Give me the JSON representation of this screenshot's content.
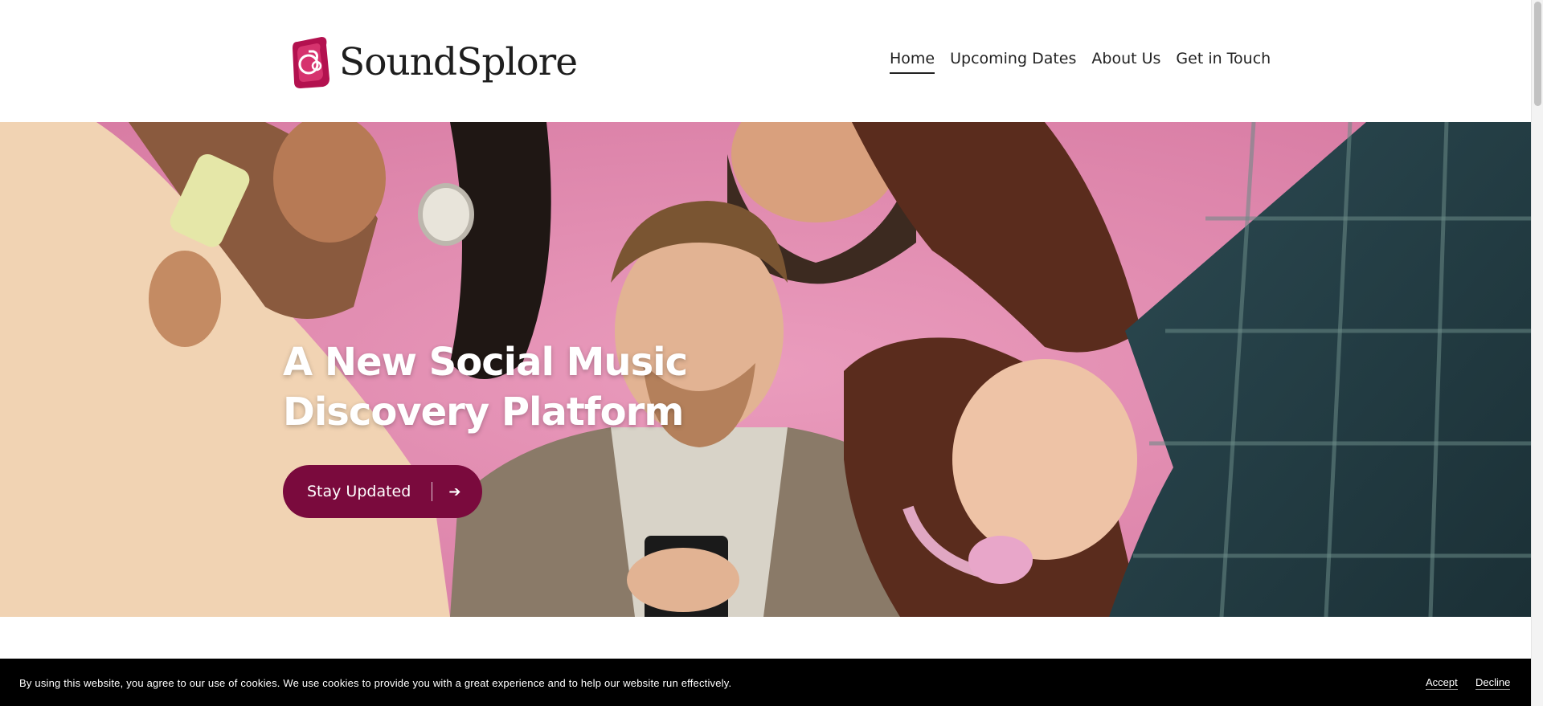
{
  "brand": {
    "name": "SoundSplore",
    "accent": "#c2185b",
    "dark_accent": "#7a0a3d"
  },
  "nav": {
    "items": [
      {
        "label": "Home",
        "active": true
      },
      {
        "label": "Upcoming Dates",
        "active": false
      },
      {
        "label": "About Us",
        "active": false
      },
      {
        "label": "Get in Touch",
        "active": false
      }
    ]
  },
  "hero": {
    "title_line1": "A New Social Music",
    "title_line2": "Discovery Platform",
    "cta_label": "Stay Updated",
    "cta_icon": "arrow-right-icon",
    "cta_arrow": "➔"
  },
  "cookie": {
    "message": "By using this website, you agree to our use of cookies. We use cookies to provide you with a great experience and to help our website run effectively.",
    "accept_label": "Accept",
    "decline_label": "Decline"
  }
}
